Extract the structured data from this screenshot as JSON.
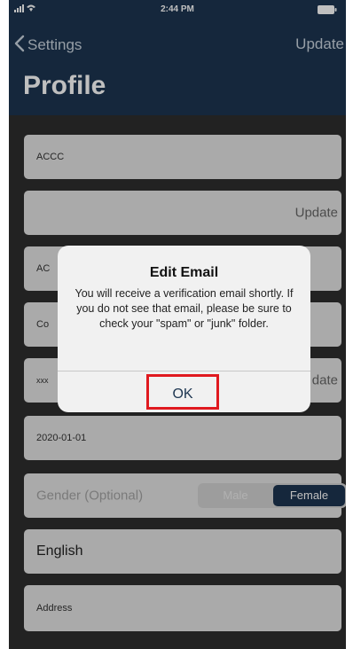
{
  "status_bar": {
    "time": "2:44 PM"
  },
  "nav": {
    "back_label": "Settings",
    "action_label": "Update",
    "title": "Profile"
  },
  "fields": {
    "name": "ACCC",
    "email_action": "Update",
    "field3": "AC",
    "field4": "Co",
    "field5": "xxx",
    "field5_action": "date",
    "birthday": "2020-01-01",
    "gender_placeholder": "Gender (Optional)",
    "gender_options": [
      "Male",
      "Female"
    ],
    "gender_selected": "Female",
    "language": "English",
    "address_placeholder": "Address"
  },
  "dialog": {
    "title": "Edit Email",
    "message": "You will receive a verification email shortly. If you do not see that email, please be sure to check your \"spam\" or \"junk\" folder.",
    "ok_label": "OK"
  },
  "colors": {
    "nav_bg": "#1d3550",
    "screen_bg": "#2e2e2e",
    "field_bg": "#e3e3e3",
    "highlight": "#e0191f"
  }
}
